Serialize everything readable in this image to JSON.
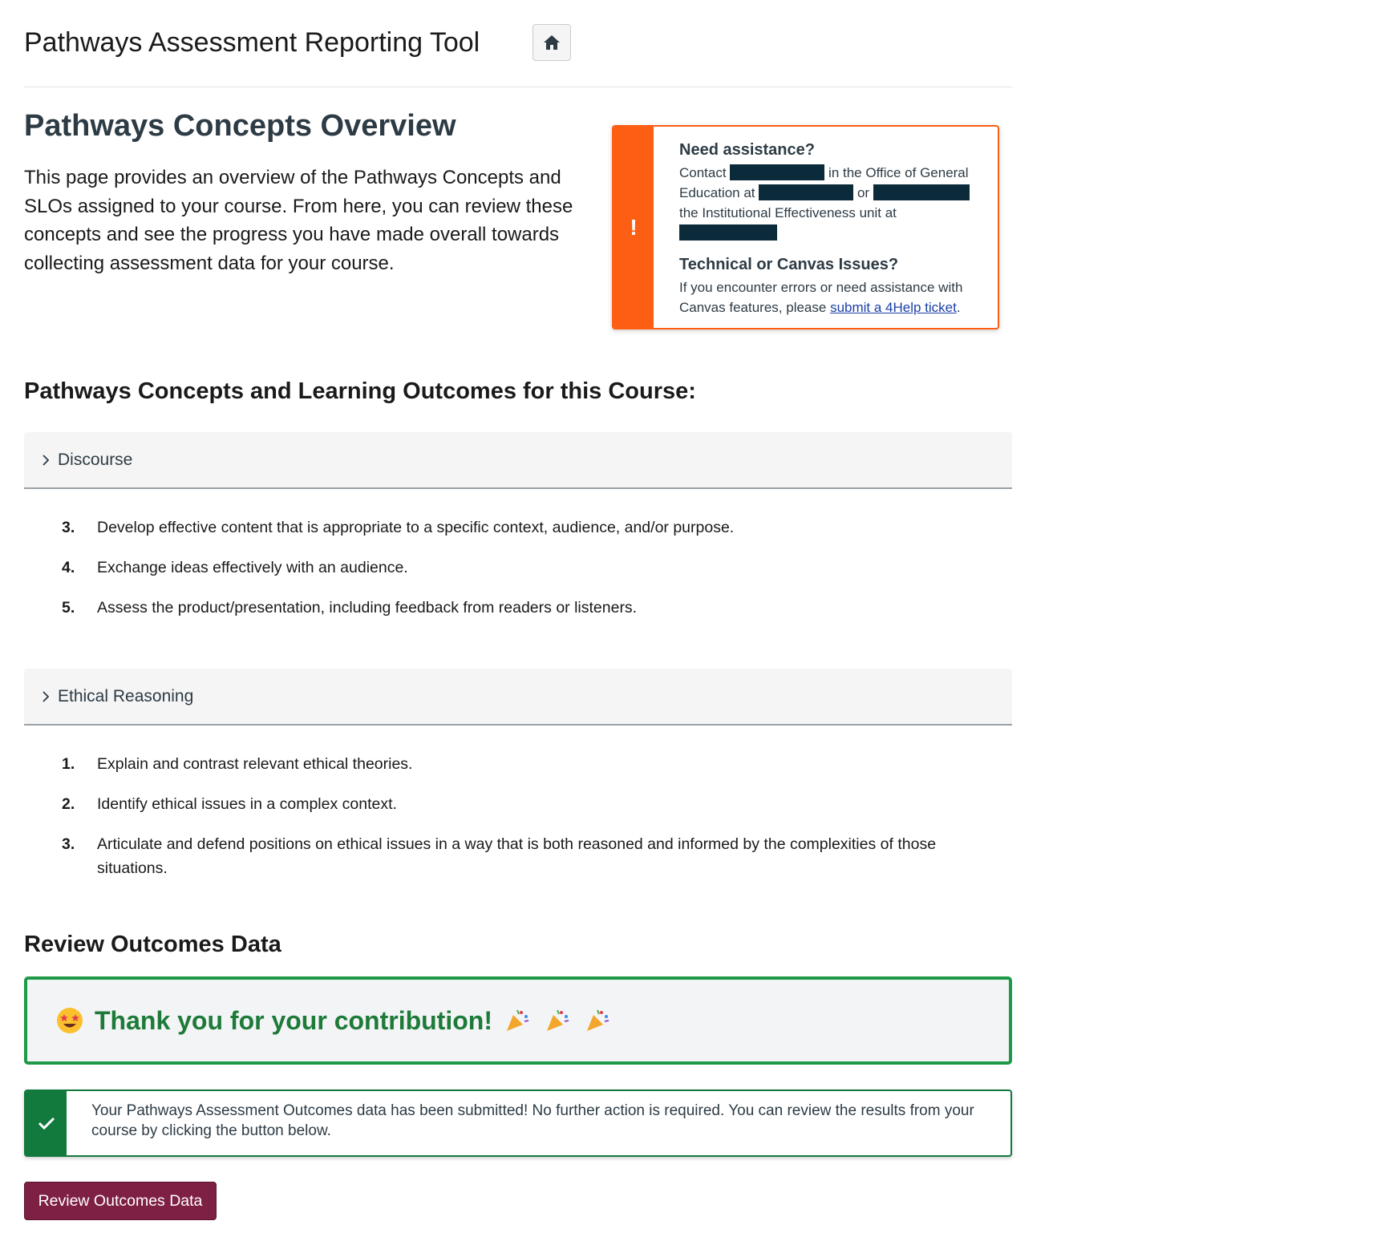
{
  "header": {
    "title": "Pathways Assessment Reporting Tool",
    "home_icon": "home-icon"
  },
  "overview": {
    "title": "Pathways Concepts Overview",
    "description": "This page provides an overview of the Pathways Concepts and SLOs assigned to your course. From here, you can review these concepts and see the progress you have made overall towards collecting assessment data for your course."
  },
  "assistance": {
    "icon": "exclamation",
    "heading": "Need assistance?",
    "contact_prefix": "Contact ",
    "contact_mid": " in the Office of General Education at ",
    "contact_or": " or ",
    "contact_suffix": "the Institutional Effectiveness unit at ",
    "tech_heading": "Technical or Canvas Issues?",
    "tech_text": "If you encounter errors or need assistance with Canvas features, please ",
    "tech_link": "submit a 4Help ticket",
    "tech_end": ".",
    "accent_color": "#fc5e13"
  },
  "concepts": {
    "title": "Pathways Concepts and Learning Outcomes for this Course:",
    "groups": [
      {
        "label": "Discourse",
        "outcomes": [
          {
            "num": "3.",
            "text": "Develop effective content that is appropriate to a specific context, audience, and/or purpose."
          },
          {
            "num": "4.",
            "text": "Exchange ideas effectively with an audience."
          },
          {
            "num": "5.",
            "text": "Assess the product/presentation, including feedback from readers or listeners."
          }
        ]
      },
      {
        "label": "Ethical Reasoning",
        "outcomes": [
          {
            "num": "1.",
            "text": "Explain and contrast relevant ethical theories."
          },
          {
            "num": "2.",
            "text": "Identify ethical issues in a complex context."
          },
          {
            "num": "3.",
            "text": "Articulate and defend positions on ethical issues in a way that is both reasoned and informed by the complexities of those situations."
          }
        ]
      }
    ]
  },
  "review": {
    "title": "Review Outcomes Data",
    "thanks_text": "Thank you for your contribution!",
    "thanks_color": "#1d7a38",
    "success_text": "Your Pathways Assessment Outcomes data has been submitted! No further action is required. You can review the results from your course by clicking the button below.",
    "success_color": "#127a3c",
    "button_label": "Review Outcomes Data",
    "button_color": "#7e1f44"
  }
}
